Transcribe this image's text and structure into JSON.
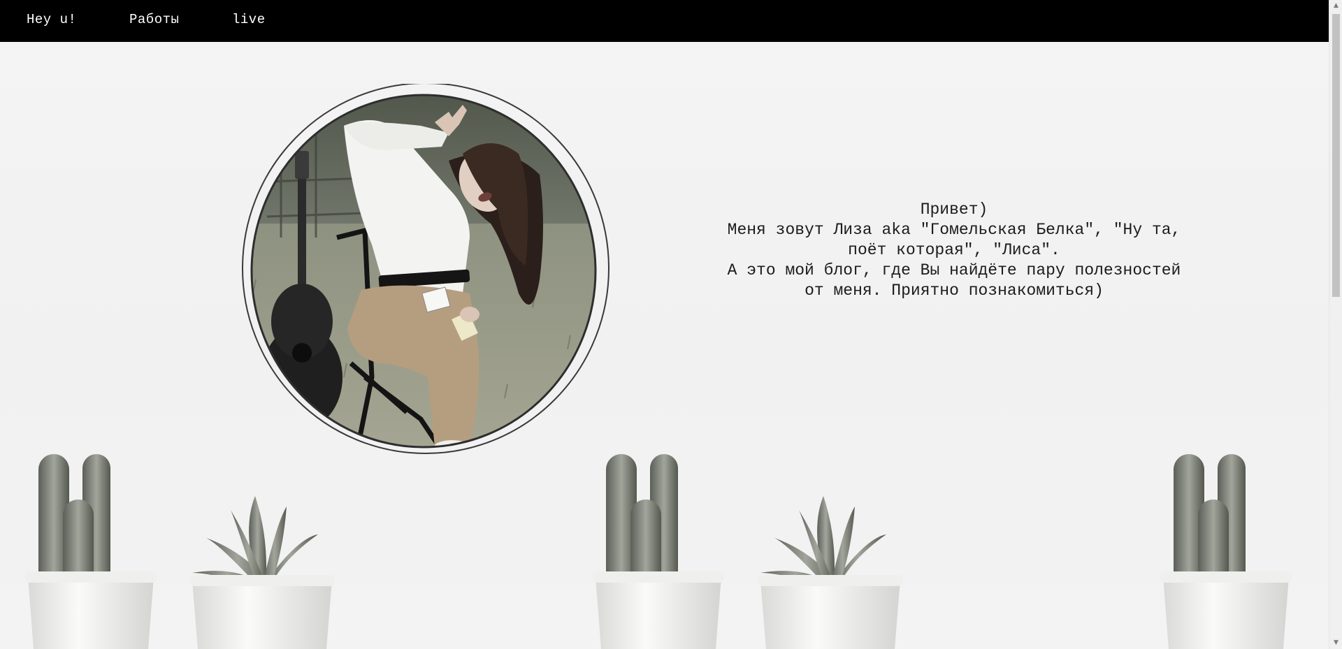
{
  "nav": {
    "items": [
      {
        "label": "Hey u!"
      },
      {
        "label": "Работы"
      },
      {
        "label": "live"
      }
    ]
  },
  "intro": {
    "lines": [
      "Привет)",
      "Меня зовут Лиза aka \"Гомельская Белка\", \"Ну та, поёт которая\", \"Лиса\".",
      "А это мой блог, где Вы найдёте пару полезностей от меня. Приятно познакомиться)"
    ]
  },
  "colors": {
    "nav_background": "#000000",
    "nav_text": "#ffffff",
    "page_background": "#f3f3f3",
    "text": "#1c1c1c"
  },
  "icons": {
    "scroll_up": "scroll-up-icon",
    "scroll_down": "scroll-down-icon"
  }
}
